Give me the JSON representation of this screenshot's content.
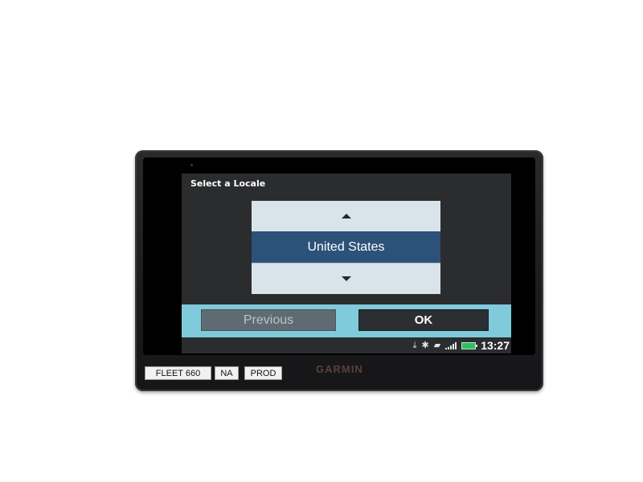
{
  "screen": {
    "title": "Select a Locale",
    "picker": {
      "selected": "United States",
      "up_icon": "triangle-up-icon",
      "down_icon": "triangle-down-icon"
    },
    "buttons": {
      "previous_label": "Previous",
      "ok_label": "OK"
    },
    "status": {
      "time": "13:27",
      "icons": [
        "download-icon",
        "bluetooth-icon",
        "car-icon",
        "signal-icon",
        "battery-icon"
      ],
      "battery_color": "#27c45a"
    },
    "colors": {
      "selected_bg": "#2c5279",
      "button_bar_bg": "#7fcbdc",
      "picker_bg": "#d9e4ea"
    }
  },
  "device": {
    "labels": [
      "FLEET 660",
      "NA",
      "PROD"
    ],
    "brand": "GARMIN"
  }
}
